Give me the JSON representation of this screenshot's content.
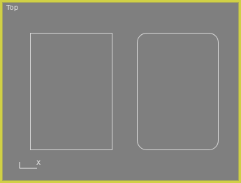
{
  "viewport": {
    "label": "Top"
  },
  "axis": {
    "x_label": "X"
  },
  "colors": {
    "viewport_bg": "#7f7f7f",
    "viewport_border_active": "#d0d045",
    "shape_outline": "#d9d9d9"
  },
  "icons": {
    "axis_gizmo": "axis-tripod-icon"
  }
}
